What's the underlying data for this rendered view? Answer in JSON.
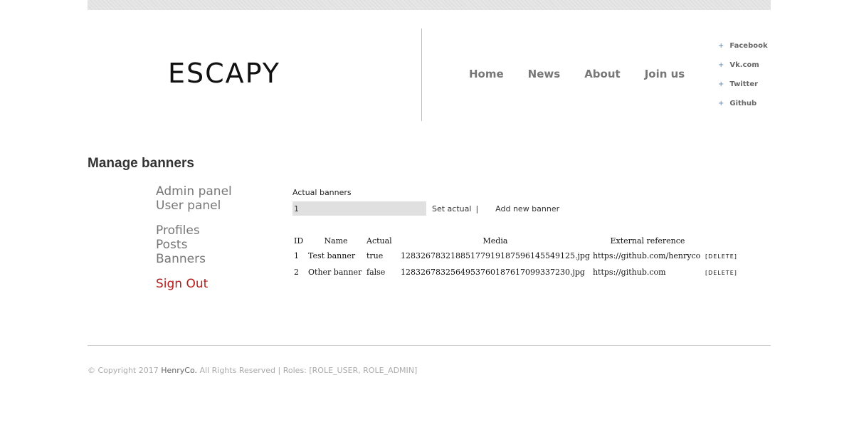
{
  "logo": {
    "text": "ESCAPY"
  },
  "nav": [
    "Home",
    "News",
    "About",
    "Join us"
  ],
  "social": [
    "Facebook",
    "Vk.com",
    "Twitter",
    "Github"
  ],
  "page_title": "Manage banners",
  "sidebar": {
    "admin_panel": "Admin panel",
    "user_panel": "User panel",
    "profiles": "Profiles",
    "posts": "Posts",
    "banners": "Banners",
    "sign_out": "Sign Out"
  },
  "actual": {
    "label": "Actual banners",
    "input_value": "1",
    "set_actual": "Set actual",
    "separator": "|",
    "add_new": "Add new banner"
  },
  "table": {
    "headers": [
      "ID",
      "Name",
      "Actual",
      "Media",
      "External reference"
    ],
    "delete_label": "[DELETE]",
    "rows": [
      {
        "id": "1",
        "name": "Test banner",
        "actual": "true",
        "media": "1283267832188517791918759614554 9125.jpg",
        "ext": "https://github.com/henryco"
      },
      {
        "id": "2",
        "name": "Other banner",
        "actual": "false",
        "media": "128326783256495376018761709933 7230.jpg",
        "ext": "https://github.com"
      }
    ]
  },
  "footer": {
    "prefix": "© Copyright 2017",
    "brand": "HenryCo.",
    "suffix": "All Rights Reserved | Roles: [ROLE_USER, ROLE_ADMIN]"
  }
}
